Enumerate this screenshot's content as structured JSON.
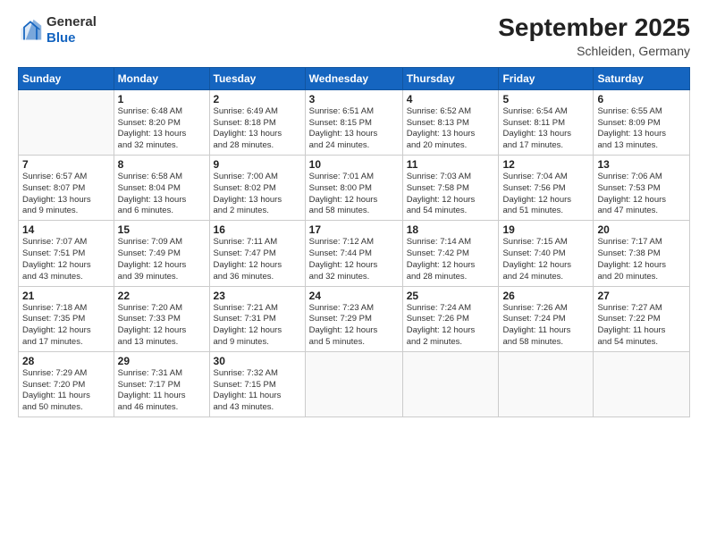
{
  "logo": {
    "general": "General",
    "blue": "Blue"
  },
  "header": {
    "month": "September 2025",
    "location": "Schleiden, Germany"
  },
  "weekdays": [
    "Sunday",
    "Monday",
    "Tuesday",
    "Wednesday",
    "Thursday",
    "Friday",
    "Saturday"
  ],
  "weeks": [
    [
      {
        "day": "",
        "info": ""
      },
      {
        "day": "1",
        "info": "Sunrise: 6:48 AM\nSunset: 8:20 PM\nDaylight: 13 hours\nand 32 minutes."
      },
      {
        "day": "2",
        "info": "Sunrise: 6:49 AM\nSunset: 8:18 PM\nDaylight: 13 hours\nand 28 minutes."
      },
      {
        "day": "3",
        "info": "Sunrise: 6:51 AM\nSunset: 8:15 PM\nDaylight: 13 hours\nand 24 minutes."
      },
      {
        "day": "4",
        "info": "Sunrise: 6:52 AM\nSunset: 8:13 PM\nDaylight: 13 hours\nand 20 minutes."
      },
      {
        "day": "5",
        "info": "Sunrise: 6:54 AM\nSunset: 8:11 PM\nDaylight: 13 hours\nand 17 minutes."
      },
      {
        "day": "6",
        "info": "Sunrise: 6:55 AM\nSunset: 8:09 PM\nDaylight: 13 hours\nand 13 minutes."
      }
    ],
    [
      {
        "day": "7",
        "info": "Sunrise: 6:57 AM\nSunset: 8:07 PM\nDaylight: 13 hours\nand 9 minutes."
      },
      {
        "day": "8",
        "info": "Sunrise: 6:58 AM\nSunset: 8:04 PM\nDaylight: 13 hours\nand 6 minutes."
      },
      {
        "day": "9",
        "info": "Sunrise: 7:00 AM\nSunset: 8:02 PM\nDaylight: 13 hours\nand 2 minutes."
      },
      {
        "day": "10",
        "info": "Sunrise: 7:01 AM\nSunset: 8:00 PM\nDaylight: 12 hours\nand 58 minutes."
      },
      {
        "day": "11",
        "info": "Sunrise: 7:03 AM\nSunset: 7:58 PM\nDaylight: 12 hours\nand 54 minutes."
      },
      {
        "day": "12",
        "info": "Sunrise: 7:04 AM\nSunset: 7:56 PM\nDaylight: 12 hours\nand 51 minutes."
      },
      {
        "day": "13",
        "info": "Sunrise: 7:06 AM\nSunset: 7:53 PM\nDaylight: 12 hours\nand 47 minutes."
      }
    ],
    [
      {
        "day": "14",
        "info": "Sunrise: 7:07 AM\nSunset: 7:51 PM\nDaylight: 12 hours\nand 43 minutes."
      },
      {
        "day": "15",
        "info": "Sunrise: 7:09 AM\nSunset: 7:49 PM\nDaylight: 12 hours\nand 39 minutes."
      },
      {
        "day": "16",
        "info": "Sunrise: 7:11 AM\nSunset: 7:47 PM\nDaylight: 12 hours\nand 36 minutes."
      },
      {
        "day": "17",
        "info": "Sunrise: 7:12 AM\nSunset: 7:44 PM\nDaylight: 12 hours\nand 32 minutes."
      },
      {
        "day": "18",
        "info": "Sunrise: 7:14 AM\nSunset: 7:42 PM\nDaylight: 12 hours\nand 28 minutes."
      },
      {
        "day": "19",
        "info": "Sunrise: 7:15 AM\nSunset: 7:40 PM\nDaylight: 12 hours\nand 24 minutes."
      },
      {
        "day": "20",
        "info": "Sunrise: 7:17 AM\nSunset: 7:38 PM\nDaylight: 12 hours\nand 20 minutes."
      }
    ],
    [
      {
        "day": "21",
        "info": "Sunrise: 7:18 AM\nSunset: 7:35 PM\nDaylight: 12 hours\nand 17 minutes."
      },
      {
        "day": "22",
        "info": "Sunrise: 7:20 AM\nSunset: 7:33 PM\nDaylight: 12 hours\nand 13 minutes."
      },
      {
        "day": "23",
        "info": "Sunrise: 7:21 AM\nSunset: 7:31 PM\nDaylight: 12 hours\nand 9 minutes."
      },
      {
        "day": "24",
        "info": "Sunrise: 7:23 AM\nSunset: 7:29 PM\nDaylight: 12 hours\nand 5 minutes."
      },
      {
        "day": "25",
        "info": "Sunrise: 7:24 AM\nSunset: 7:26 PM\nDaylight: 12 hours\nand 2 minutes."
      },
      {
        "day": "26",
        "info": "Sunrise: 7:26 AM\nSunset: 7:24 PM\nDaylight: 11 hours\nand 58 minutes."
      },
      {
        "day": "27",
        "info": "Sunrise: 7:27 AM\nSunset: 7:22 PM\nDaylight: 11 hours\nand 54 minutes."
      }
    ],
    [
      {
        "day": "28",
        "info": "Sunrise: 7:29 AM\nSunset: 7:20 PM\nDaylight: 11 hours\nand 50 minutes."
      },
      {
        "day": "29",
        "info": "Sunrise: 7:31 AM\nSunset: 7:17 PM\nDaylight: 11 hours\nand 46 minutes."
      },
      {
        "day": "30",
        "info": "Sunrise: 7:32 AM\nSunset: 7:15 PM\nDaylight: 11 hours\nand 43 minutes."
      },
      {
        "day": "",
        "info": ""
      },
      {
        "day": "",
        "info": ""
      },
      {
        "day": "",
        "info": ""
      },
      {
        "day": "",
        "info": ""
      }
    ]
  ]
}
